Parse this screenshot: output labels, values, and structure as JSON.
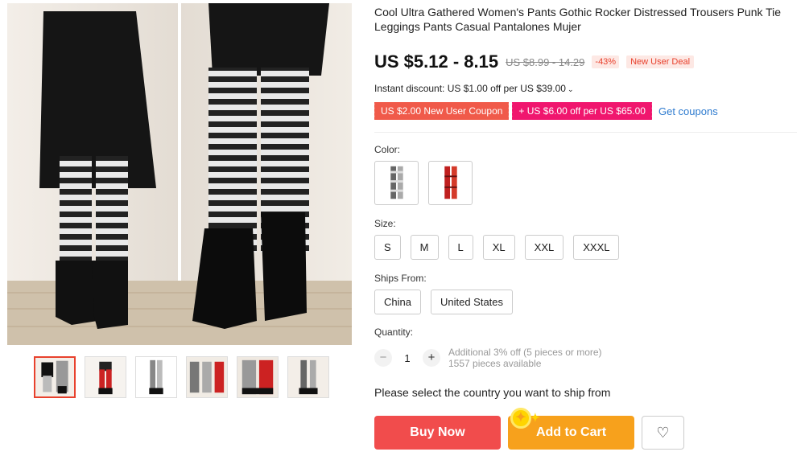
{
  "product": {
    "title": "Cool Ultra Gathered Women's Pants Gothic Rocker Distressed Trousers Punk Tie Leggings Pants Casual Pantalones Mujer",
    "price": "US $5.12 - 8.15",
    "old_price": "US $8.99 - 14.29",
    "discount_pct": "-43%",
    "deal_badge": "New User Deal",
    "instant_discount": "Instant discount: US $1.00 off per US $39.00",
    "coupons": [
      "US $2.00 New User Coupon",
      "+ US $6.00 off per US $65.00"
    ],
    "get_coupons": "Get coupons"
  },
  "color": {
    "label": "Color:",
    "options": [
      "grey-white",
      "red"
    ]
  },
  "size": {
    "label": "Size:",
    "options": [
      "S",
      "M",
      "L",
      "XL",
      "XXL",
      "XXXL"
    ]
  },
  "ships_from": {
    "label": "Ships From:",
    "options": [
      "China",
      "United States"
    ]
  },
  "quantity": {
    "label": "Quantity:",
    "value": "1",
    "minus": "−",
    "plus": "+",
    "additional": "Additional 3% off (5 pieces or more)",
    "available": "1557 pieces available"
  },
  "ship_note": "Please select the country you want to ship from",
  "actions": {
    "buy_now": "Buy Now",
    "add_to_cart": "Add to Cart",
    "wishlist_icon": "heart-icon"
  },
  "colors": {
    "buy_now_bg": "#f14c4c",
    "add_to_cart_bg": "#f7a11c",
    "coupon_red": "#f05a4a",
    "coupon_pink": "#f0166e",
    "link": "#2e7bcf",
    "active_thumb_border": "#e8412d"
  }
}
